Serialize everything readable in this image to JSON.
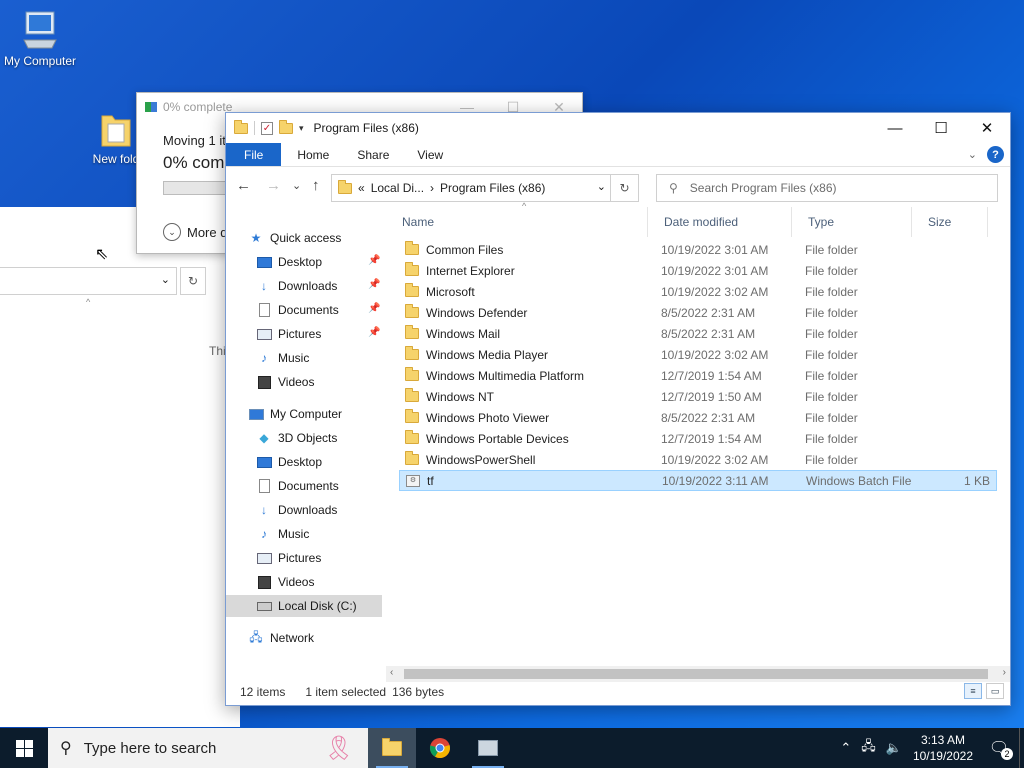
{
  "desktop": {
    "icons": [
      {
        "label": "My Computer"
      },
      {
        "label": "New fold"
      }
    ]
  },
  "progress_dialog": {
    "title": "0% complete",
    "moving_text": "Moving 1 it",
    "percent_text": "0% comp",
    "more_details": "More d",
    "controls": {
      "min": "—",
      "max": "☐",
      "close": "✕"
    }
  },
  "background_window": {
    "partial_text": "Thi"
  },
  "explorer": {
    "title": "Program Files (x86)",
    "controls": {
      "min": "—",
      "max": "☐",
      "close": "✕"
    },
    "ribbon_tabs": [
      "File",
      "Home",
      "Share",
      "View"
    ],
    "help": "?",
    "nav": {
      "back": "←",
      "forward": "→",
      "recent": "⌄",
      "up": "↑"
    },
    "address": {
      "prefix": "«",
      "seg1": "Local Di...",
      "sep": "›",
      "seg2": "Program Files (x86)"
    },
    "search_placeholder": "Search Program Files (x86)",
    "sidebar": {
      "quick_access": "Quick access",
      "quick_items": [
        "Desktop",
        "Downloads",
        "Documents",
        "Pictures",
        "Music",
        "Videos"
      ],
      "my_computer": "My Computer",
      "computer_items": [
        "3D Objects",
        "Desktop",
        "Documents",
        "Downloads",
        "Music",
        "Pictures",
        "Videos",
        "Local Disk (C:)"
      ],
      "network": "Network"
    },
    "columns": [
      "Name",
      "Date modified",
      "Type",
      "Size"
    ],
    "files": [
      {
        "name": "Common Files",
        "date": "10/19/2022 3:01 AM",
        "type": "File folder",
        "size": ""
      },
      {
        "name": "Internet Explorer",
        "date": "10/19/2022 3:01 AM",
        "type": "File folder",
        "size": ""
      },
      {
        "name": "Microsoft",
        "date": "10/19/2022 3:02 AM",
        "type": "File folder",
        "size": ""
      },
      {
        "name": "Windows Defender",
        "date": "8/5/2022 2:31 AM",
        "type": "File folder",
        "size": ""
      },
      {
        "name": "Windows Mail",
        "date": "8/5/2022 2:31 AM",
        "type": "File folder",
        "size": ""
      },
      {
        "name": "Windows Media Player",
        "date": "10/19/2022 3:02 AM",
        "type": "File folder",
        "size": ""
      },
      {
        "name": "Windows Multimedia Platform",
        "date": "12/7/2019 1:54 AM",
        "type": "File folder",
        "size": ""
      },
      {
        "name": "Windows NT",
        "date": "12/7/2019 1:50 AM",
        "type": "File folder",
        "size": ""
      },
      {
        "name": "Windows Photo Viewer",
        "date": "8/5/2022 2:31 AM",
        "type": "File folder",
        "size": ""
      },
      {
        "name": "Windows Portable Devices",
        "date": "12/7/2019 1:54 AM",
        "type": "File folder",
        "size": ""
      },
      {
        "name": "WindowsPowerShell",
        "date": "10/19/2022 3:02 AM",
        "type": "File folder",
        "size": ""
      },
      {
        "name": "tf",
        "date": "10/19/2022 3:11 AM",
        "type": "Windows Batch File",
        "size": "1 KB"
      }
    ],
    "status": {
      "items": "12 items",
      "selected": "1 item selected",
      "bytes": "136 bytes"
    }
  },
  "taskbar": {
    "search_placeholder": "Type here to search",
    "time": "3:13 AM",
    "date": "10/19/2022",
    "notification_count": "2"
  },
  "colors": {
    "accent": "#1a66c9",
    "selection": "#cce8ff",
    "taskbar": "#0c1c2c"
  }
}
